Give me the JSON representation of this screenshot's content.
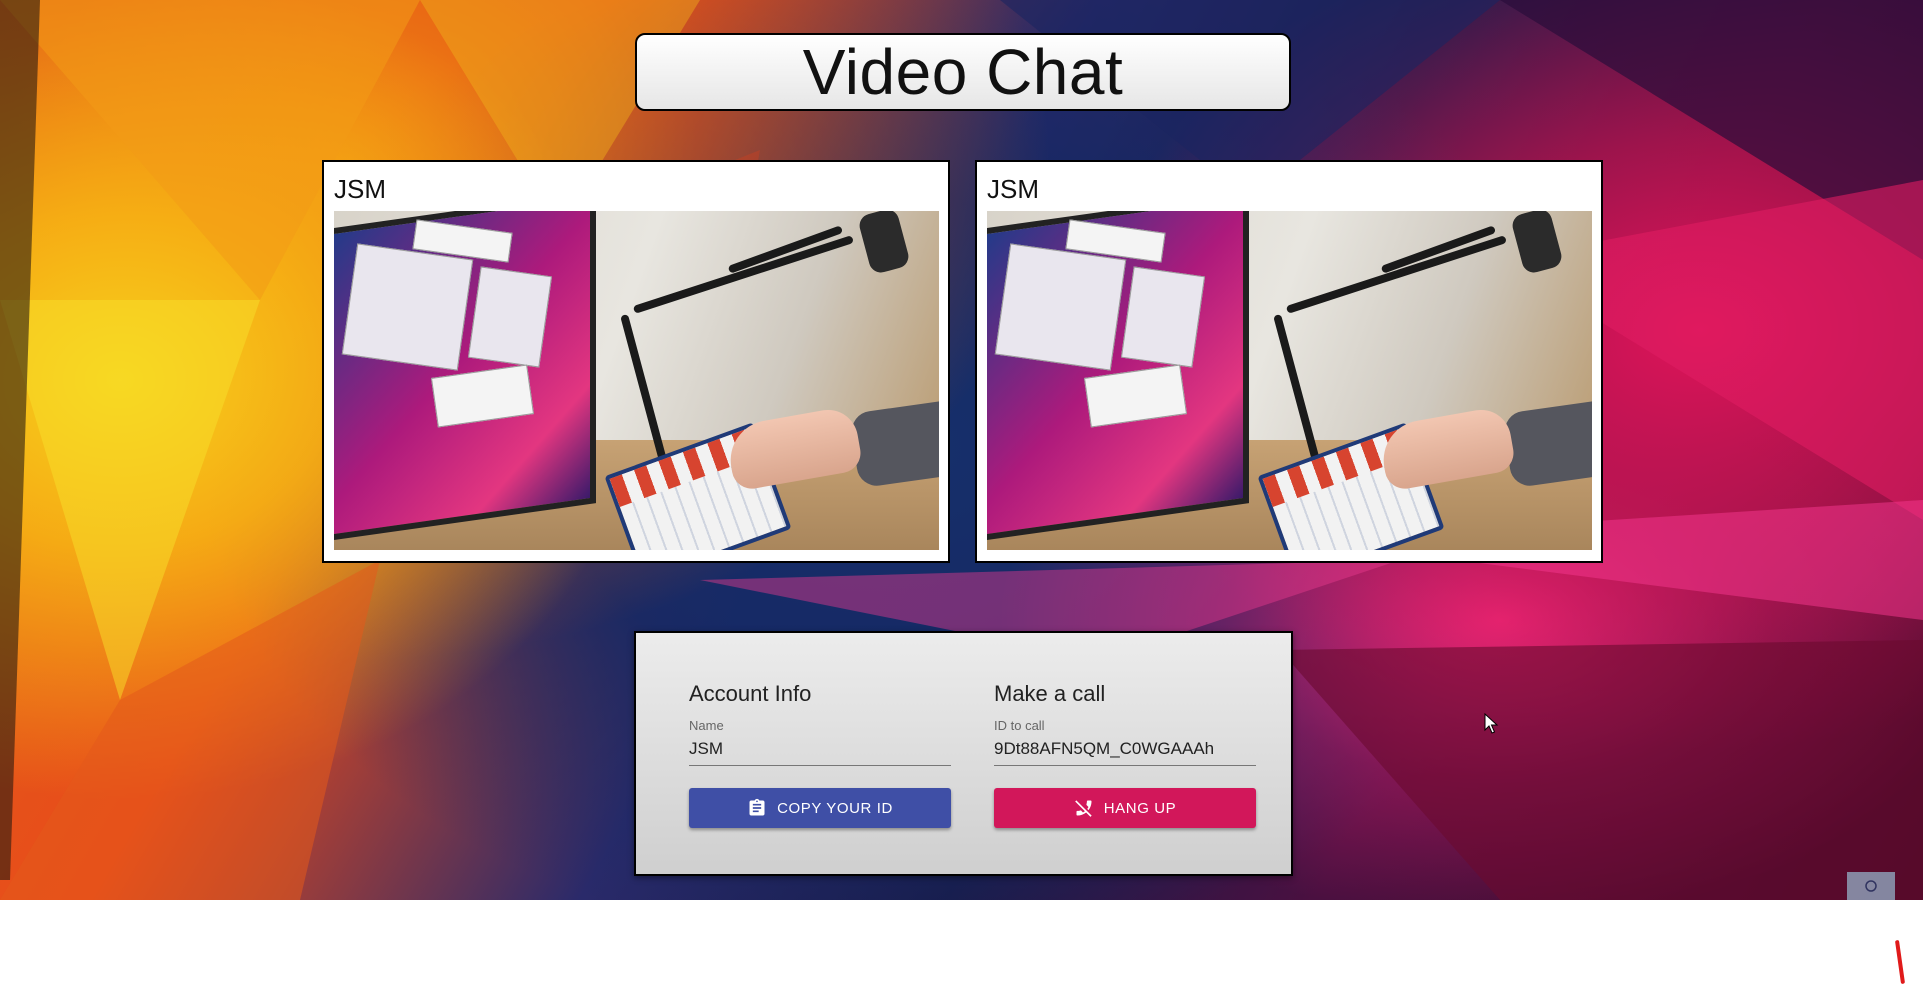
{
  "app": {
    "title": "Video Chat"
  },
  "videos": [
    {
      "name": "JSM"
    },
    {
      "name": "JSM"
    }
  ],
  "panel": {
    "account": {
      "heading": "Account Info",
      "name_label": "Name",
      "name_value": "JSM",
      "copy_button": "COPY YOUR ID"
    },
    "call": {
      "heading": "Make a call",
      "id_label": "ID to call",
      "id_value": "9Dt88AFN5QM_C0WGAAAh",
      "hangup_button": "HANG UP"
    }
  },
  "icons": {
    "copy": "clipboard-icon",
    "hangup": "phone-disabled-icon",
    "cursor": "mouse-pointer-icon"
  },
  "colors": {
    "copy_button": "#3f4fa6",
    "hangup_button": "#d2175a"
  }
}
